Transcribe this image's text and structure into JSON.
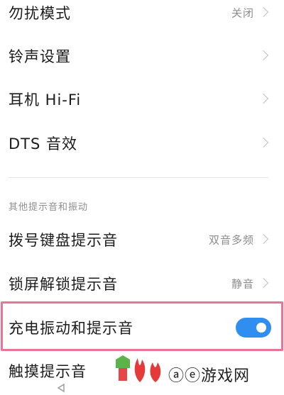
{
  "settings_rows": [
    {
      "title": "勿扰模式",
      "value": "关闭"
    },
    {
      "title": "铃声设置",
      "value": ""
    },
    {
      "title": "耳机 Hi-Fi",
      "value": ""
    },
    {
      "title": "DTS 音效",
      "value": ""
    }
  ],
  "section": {
    "header": "其他提示音和振动",
    "rows": [
      {
        "title": "拨号键盘提示音",
        "value": "双音多频"
      },
      {
        "title": "锁屏解锁提示音",
        "value": "静音"
      }
    ]
  },
  "charging": {
    "title": "充电振动和提示音",
    "toggle_on": true
  },
  "partial_row": {
    "title": "触摸提示音"
  },
  "watermark": {
    "text": "ⓐⓔ游戏网"
  },
  "colors": {
    "toggle": "#2f8ef0",
    "highlight_border": "#e97596",
    "value_text": "#8c8c8c"
  },
  "icons": [
    "chevron-right-icon",
    "back-nav-icon",
    "watermark-logo-icon"
  ]
}
